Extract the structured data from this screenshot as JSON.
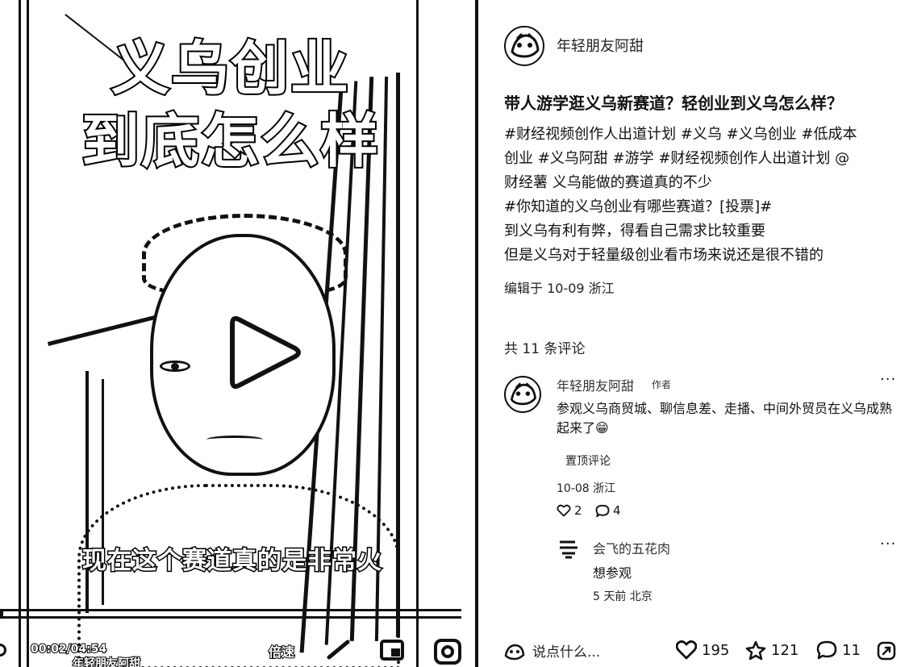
{
  "video": {
    "title_line1": "义乌创业",
    "title_line2": "到底怎么样",
    "subtitle": "现在这个赛道真的是非常火",
    "time": "00:02/04:54",
    "speed": "倍速",
    "author_overlay": "年轻朋友阿甜",
    "progress": 0.007
  },
  "post": {
    "author": "年轻朋友阿甜",
    "title": "带人游学逛义乌新赛道？轻创业到义乌怎么样？",
    "body_lines": [
      "#财经视频创作人出道计划 #义乌 #义乌创业 #低成本",
      "创业 #义乌阿甜 #游学 #财经视频创作人出道计划 @",
      "财经薯 义乌能做的赛道真的不少",
      "#你知道的义乌创业有哪些赛道？[投票]#",
      "到义乌有利有弊，得看自己需求比较重要",
      "但是义乌对于轻量级创业看市场来说还是很不错的"
    ],
    "meta": "编辑于 10-09 浙江"
  },
  "comments": {
    "count_label": "共 11 条评论",
    "first": {
      "author": "年轻朋友阿甜",
      "tag": "作者",
      "more": "···",
      "text": "参观义乌商贸城、聊信息差、走播、中间外贸员在义乌成熟起来了😁",
      "pin_label": "置顶评论",
      "date": "10-08 浙江",
      "likes": "2",
      "replies": "4"
    },
    "reply": {
      "author": "会飞的五花肉",
      "more": "···",
      "text": "想参观",
      "date": "5 天前 北京"
    }
  },
  "bottom": {
    "placeholder": "说点什么...",
    "likes": "195",
    "collects": "121",
    "comments": "11"
  },
  "icons": {
    "play": "play-icon",
    "like": "heart-icon",
    "collect": "star-icon",
    "comment": "speech-bubble-icon",
    "share": "share-icon"
  }
}
